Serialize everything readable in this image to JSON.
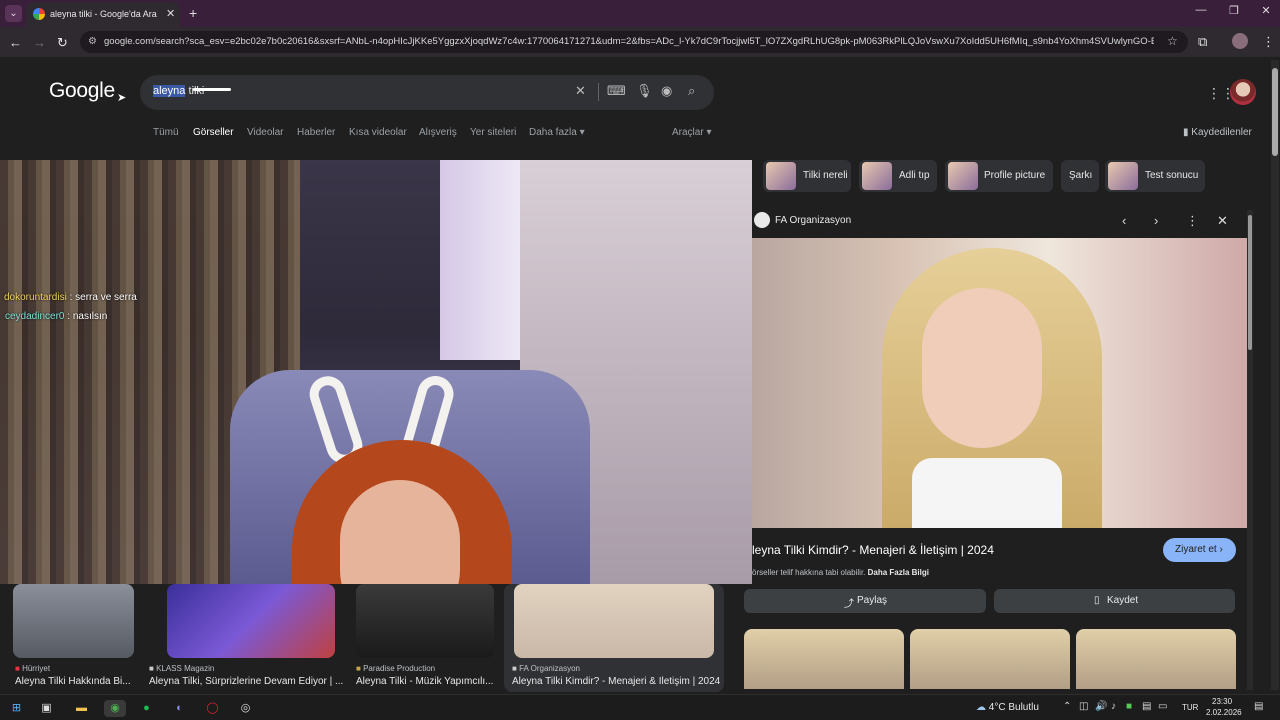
{
  "browser": {
    "tab_title": "aleyna tilki - Google'da Ara",
    "url": "google.com/search?sca_esv=e2bc02e7b0c20616&sxsrf=ANbL-n4opHIcJjKKe5YggzxXjoqdWz7c4w:1770064171271&udm=2&fbs=ADc_l-Yk7dC9rTocjjwl5T_lO7ZXgdRLhUG8pk-pM063RkPlLQJoVswXu7XoIdd5UH6fMIq_s9nb4YoXhm4SVUwlynGO-EpI1wixZIXl...",
    "accent": "#3a1f3a"
  },
  "google": {
    "logo": "Google",
    "query_selected": "aleyna",
    "query_rest": " tilki",
    "tabs": [
      "Tümü",
      "Görseller",
      "Videolar",
      "Haberler",
      "Kısa videolar",
      "Alışveriş",
      "Yer siteleri",
      "Daha fazla ▾"
    ],
    "active_tab": "Görseller",
    "tools": "Araçlar ▾",
    "saved": "Kaydedilenler"
  },
  "stream_chat": [
    {
      "user": "dokoruntardisi",
      "sep": " : ",
      "msg": "serra ve serra"
    },
    {
      "user": "ceydadincer0",
      "sep": " : ",
      "msg": "nasılsın"
    }
  ],
  "results": [
    {
      "source": "Hürriyet",
      "title": "Aleyna Tilki Hakkında Bi..."
    },
    {
      "source": "KLASS Magazin",
      "title": "Aleyna Tilki, Sürprizlerine Devam Ediyor | ..."
    },
    {
      "source": "Paradise Production",
      "title": "Aleyna Tilki - Müzik Yapımcılı..."
    },
    {
      "source": "FA Organizasyon",
      "title": "Aleyna Tilki Kimdir? - Menajeri & İletişim | 2024"
    }
  ],
  "chips": [
    "Tilki nereli",
    "Adli tıp",
    "Profile picture",
    "Şarkı",
    "Test sonucu"
  ],
  "panel": {
    "source": "FA Organizasyon",
    "title": "leyna Tilki Kimdir? - Menajeri & İletişim | 2024",
    "visit": "Ziyaret et ›",
    "copyright": "örseller telif hakkına tabi olabilir. ",
    "more_info": "Daha Fazla Bilgi",
    "share": "Paylaş",
    "save": "Kaydet"
  },
  "taskbar": {
    "weather": "4°C  Bulutlu",
    "lang": "TUR",
    "time": "23:30",
    "date": "2.02.2026"
  }
}
